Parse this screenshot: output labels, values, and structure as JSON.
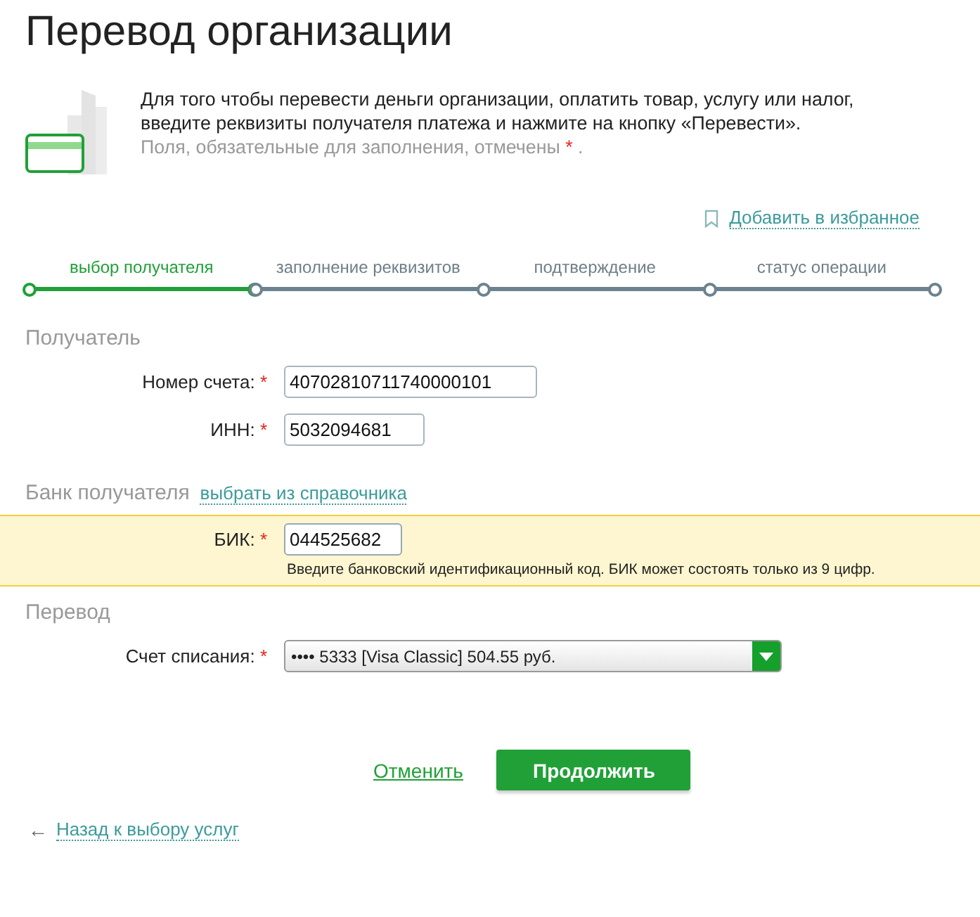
{
  "title": "Перевод организации",
  "intro": {
    "text": "Для того чтобы перевести деньги организации, оплатить товар, услугу или налог, введите реквизиты получателя платежа и нажмите на кнопку «Перевести».",
    "note": "Поля, обязательные для заполнения, отмечены",
    "note_mark": "*",
    "note_end": "."
  },
  "favorite_link": "Добавить в избранное",
  "steps": [
    {
      "label": "выбор получателя",
      "selected": true
    },
    {
      "label": "заполнение реквизитов",
      "selected": false
    },
    {
      "label": "подтверждение",
      "selected": false
    },
    {
      "label": "статус операции",
      "selected": false
    }
  ],
  "sections": [
    {
      "title": "Получатель",
      "fields": [
        {
          "kind": "text",
          "label": "Номер счета:",
          "marker": "*",
          "value": "40702810711740000101",
          "highlighted": false
        },
        {
          "kind": "text",
          "label": "ИНН:",
          "marker": "*",
          "value": "5032094681",
          "highlighted": false
        }
      ]
    },
    {
      "title": "Банк получателя",
      "link": "выбрать из справочника",
      "fields": [
        {
          "kind": "text",
          "label": "БИК:",
          "marker": "*",
          "value": "044525682",
          "highlighted": true,
          "hint": "Введите банковский идентификационный код. БИК может состоять только из 9 цифр."
        }
      ]
    },
    {
      "title": "Перевод",
      "fields": [
        {
          "kind": "select",
          "label": "Счет списания:",
          "marker": "*",
          "value": "•••• 5333 [Visa Classic] 504.55 руб.",
          "highlighted": false
        }
      ]
    }
  ],
  "cancel": "Отменить",
  "continue": "Продолжить",
  "back_arrow": "←",
  "back_link": "Назад к выбору услуг"
}
